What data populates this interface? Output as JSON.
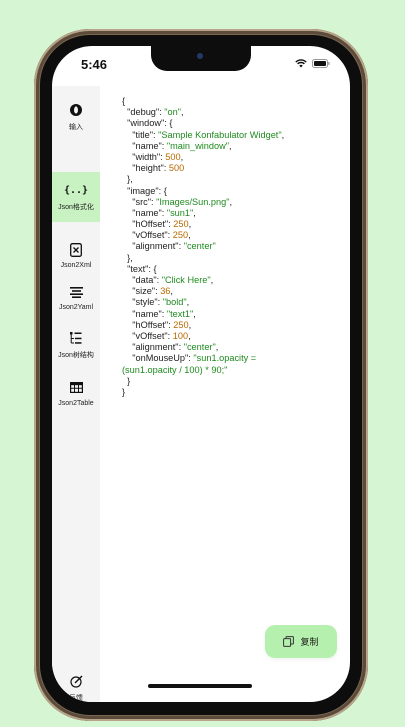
{
  "status_bar": {
    "time": "5:46"
  },
  "sidebar": {
    "items": [
      {
        "label": "输入",
        "icon": "input-icon"
      },
      {
        "label": "Json格式化",
        "icon": "braces-icon",
        "active": true
      },
      {
        "label": "Json2Xml",
        "icon": "xml-icon"
      },
      {
        "label": "Json2Yaml",
        "icon": "list-icon"
      },
      {
        "label": "Json树结构",
        "icon": "tree-icon"
      },
      {
        "label": "Json2Table",
        "icon": "table-icon"
      }
    ],
    "feedback_label": "反馈"
  },
  "code_lines": [
    [
      [
        "k",
        "{"
      ]
    ],
    [
      [
        "k",
        "  \"debug\": "
      ],
      [
        "s",
        "\"on\""
      ],
      [
        "k",
        ","
      ]
    ],
    [
      [
        "k",
        "  \"window\": {"
      ]
    ],
    [
      [
        "k",
        "    \"title\": "
      ],
      [
        "s",
        "\"Sample Konfabulator Widget\""
      ],
      [
        "k",
        ","
      ]
    ],
    [
      [
        "k",
        "    \"name\": "
      ],
      [
        "s",
        "\"main_window\""
      ],
      [
        "k",
        ","
      ]
    ],
    [
      [
        "k",
        "    \"width\": "
      ],
      [
        "n",
        "500"
      ],
      [
        "k",
        ","
      ]
    ],
    [
      [
        "k",
        "    \"height\": "
      ],
      [
        "n",
        "500"
      ]
    ],
    [
      [
        "k",
        "  },"
      ]
    ],
    [
      [
        "k",
        "  \"image\": {"
      ]
    ],
    [
      [
        "k",
        "    \"src\": "
      ],
      [
        "s",
        "\"Images/Sun.png\""
      ],
      [
        "k",
        ","
      ]
    ],
    [
      [
        "k",
        "    \"name\": "
      ],
      [
        "s",
        "\"sun1\""
      ],
      [
        "k",
        ","
      ]
    ],
    [
      [
        "k",
        "    \"hOffset\": "
      ],
      [
        "n",
        "250"
      ],
      [
        "k",
        ","
      ]
    ],
    [
      [
        "k",
        "    \"vOffset\": "
      ],
      [
        "n",
        "250"
      ],
      [
        "k",
        ","
      ]
    ],
    [
      [
        "k",
        "    \"alignment\": "
      ],
      [
        "s",
        "\"center\""
      ]
    ],
    [
      [
        "k",
        "  },"
      ]
    ],
    [
      [
        "k",
        "  \"text\": {"
      ]
    ],
    [
      [
        "k",
        "    \"data\": "
      ],
      [
        "s",
        "\"Click Here\""
      ],
      [
        "k",
        ","
      ]
    ],
    [
      [
        "k",
        "    \"size\": "
      ],
      [
        "n",
        "36"
      ],
      [
        "k",
        ","
      ]
    ],
    [
      [
        "k",
        "    \"style\": "
      ],
      [
        "s",
        "\"bold\""
      ],
      [
        "k",
        ","
      ]
    ],
    [
      [
        "k",
        "    \"name\": "
      ],
      [
        "s",
        "\"text1\""
      ],
      [
        "k",
        ","
      ]
    ],
    [
      [
        "k",
        "    \"hOffset\": "
      ],
      [
        "n",
        "250"
      ],
      [
        "k",
        ","
      ]
    ],
    [
      [
        "k",
        "    \"vOffset\": "
      ],
      [
        "n",
        "100"
      ],
      [
        "k",
        ","
      ]
    ],
    [
      [
        "k",
        "    \"alignment\": "
      ],
      [
        "s",
        "\"center\""
      ],
      [
        "k",
        ","
      ]
    ],
    [
      [
        "k",
        "    \"onMouseUp\": "
      ],
      [
        "s",
        "\"sun1.opacity ="
      ]
    ],
    [
      [
        "s",
        "(sun1.opacity / 100) * 90;\""
      ]
    ],
    [
      [
        "k",
        "  }"
      ]
    ],
    [
      [
        "k",
        "}"
      ]
    ]
  ],
  "copy_button": {
    "label": "复制"
  }
}
